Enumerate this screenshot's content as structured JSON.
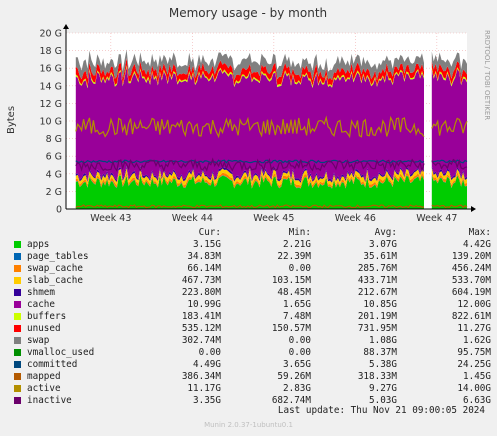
{
  "chart_data": {
    "type": "area",
    "title": "Memory usage - by month",
    "ylabel": "Bytes",
    "side_label": "RRDTOOL / TOBI OETIKER",
    "ylim": [
      0,
      20
    ],
    "y_ticks": [
      "0",
      "2 G",
      "4 G",
      "6 G",
      "8 G",
      "10 G",
      "12 G",
      "14 G",
      "16 G",
      "18 G",
      "20 G"
    ],
    "x_ticks": [
      "Week 43",
      "Week 44",
      "Week 45",
      "Week 46",
      "Week 47"
    ],
    "x_tick_positions": [
      1.0,
      2.0,
      3.0,
      4.0,
      5.0
    ],
    "x_range": [
      0.45,
      5.37
    ],
    "series_stack_gb": [
      {
        "name": "apps",
        "color": "#00cc00",
        "value": 3.07
      },
      {
        "name": "page_tables",
        "color": "#0066b3",
        "value": 0.036
      },
      {
        "name": "swap_cache",
        "color": "#ff8000",
        "value": 0.29
      },
      {
        "name": "slab_cache",
        "color": "#ffcc00",
        "value": 0.43
      },
      {
        "name": "shmem",
        "color": "#330099",
        "value": 0.21
      },
      {
        "name": "cache",
        "color": "#990099",
        "value": 10.85
      },
      {
        "name": "buffers",
        "color": "#ccff00",
        "value": 0.2
      },
      {
        "name": "unused",
        "color": "#ff0000",
        "value": 0.73
      },
      {
        "name": "swap",
        "color": "#808080",
        "value": 1.08
      }
    ],
    "line_series": [
      {
        "name": "committed",
        "color": "#00487d",
        "level": 5.4
      },
      {
        "name": "mapped",
        "color": "#b35a00",
        "level": 0.3
      },
      {
        "name": "active",
        "color": "#b38f00",
        "level": 9.3
      },
      {
        "name": "inactive",
        "color": "#6b006b",
        "level": 5.0
      }
    ],
    "gap": [
      4.86,
      4.93
    ]
  },
  "legend": {
    "headers": [
      "Cur:",
      "Min:",
      "Avg:",
      "Max:"
    ],
    "rows": [
      {
        "name": "apps",
        "color": "#00cc00",
        "cur": "3.15G",
        "min": "2.21G",
        "avg": "3.07G",
        "max": "4.42G"
      },
      {
        "name": "page_tables",
        "color": "#0066b3",
        "cur": "34.83M",
        "min": "22.39M",
        "avg": "35.61M",
        "max": "139.20M"
      },
      {
        "name": "swap_cache",
        "color": "#ff8000",
        "cur": "66.14M",
        "min": "0.00",
        "avg": "285.76M",
        "max": "456.24M"
      },
      {
        "name": "slab_cache",
        "color": "#ffcc00",
        "cur": "467.73M",
        "min": "103.15M",
        "avg": "433.71M",
        "max": "533.70M"
      },
      {
        "name": "shmem",
        "color": "#330099",
        "cur": "223.80M",
        "min": "48.45M",
        "avg": "212.67M",
        "max": "604.19M"
      },
      {
        "name": "cache",
        "color": "#990099",
        "cur": "10.99G",
        "min": "1.65G",
        "avg": "10.85G",
        "max": "12.00G"
      },
      {
        "name": "buffers",
        "color": "#ccff00",
        "cur": "183.41M",
        "min": "7.48M",
        "avg": "201.19M",
        "max": "822.61M"
      },
      {
        "name": "unused",
        "color": "#ff0000",
        "cur": "535.12M",
        "min": "150.57M",
        "avg": "731.95M",
        "max": "11.27G"
      },
      {
        "name": "swap",
        "color": "#808080",
        "cur": "302.74M",
        "min": "0.00",
        "avg": "1.08G",
        "max": "1.62G"
      },
      {
        "name": "vmalloc_used",
        "color": "#008f00",
        "cur": "0.00",
        "min": "0.00",
        "avg": "88.37M",
        "max": "95.75M"
      },
      {
        "name": "committed",
        "color": "#00487d",
        "cur": "4.49G",
        "min": "3.65G",
        "avg": "5.38G",
        "max": "24.25G"
      },
      {
        "name": "mapped",
        "color": "#b35a00",
        "cur": "386.34M",
        "min": "59.26M",
        "avg": "318.33M",
        "max": "1.45G"
      },
      {
        "name": "active",
        "color": "#b38f00",
        "cur": "11.17G",
        "min": "2.83G",
        "avg": "9.27G",
        "max": "14.00G"
      },
      {
        "name": "inactive",
        "color": "#6b006b",
        "cur": "3.35G",
        "min": "682.74M",
        "avg": "5.03G",
        "max": "6.63G"
      }
    ]
  },
  "last_update": "Last update: Thu Nov 21 09:00:05 2024",
  "footer": "Munin 2.0.37-1ubuntu0.1"
}
